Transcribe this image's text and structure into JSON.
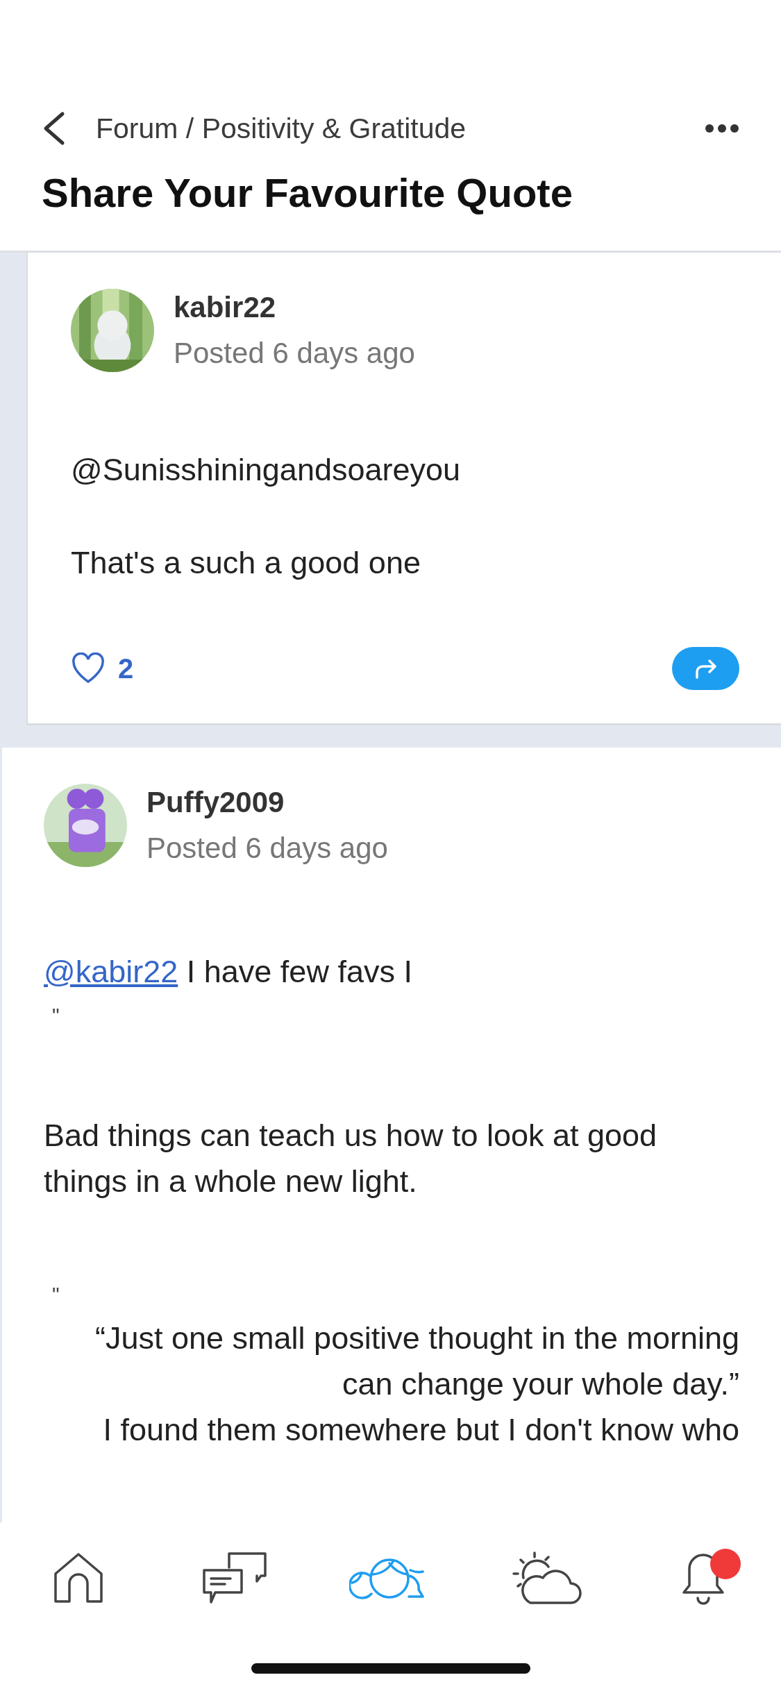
{
  "header": {
    "breadcrumb": "Forum / Positivity & Gratitude",
    "title": "Share Your Favourite Quote"
  },
  "posts": [
    {
      "author": "kabir22",
      "posted": "Posted 6 days ago",
      "indent": true,
      "paragraphs": [
        {
          "kind": "text",
          "text": "@Sunisshiningandsoareyou"
        },
        {
          "kind": "text",
          "text": "That's a such a good one"
        }
      ],
      "likes": "2",
      "liked": false
    },
    {
      "author": "Puffy2009",
      "posted": "Posted 6 days ago",
      "indent": false,
      "paragraphs": [
        {
          "kind": "mention",
          "mention": "@kabir22",
          "text": " I have few favs I"
        },
        {
          "kind": "mark",
          "text": "\""
        },
        {
          "kind": "text",
          "text": "Bad things can teach us how to look at good things in a whole new light."
        },
        {
          "kind": "mark",
          "text": "\""
        },
        {
          "kind": "quote",
          "text": "“Just one small positive thought in the morning can change your whole day.”"
        },
        {
          "kind": "quote",
          "text": "I found them somewhere but I don't know who"
        }
      ]
    }
  ],
  "tabs": [
    {
      "selected": false
    },
    {
      "selected": false
    },
    {
      "selected": true
    },
    {
      "selected": false
    },
    {
      "selected": false,
      "badge": true
    }
  ]
}
